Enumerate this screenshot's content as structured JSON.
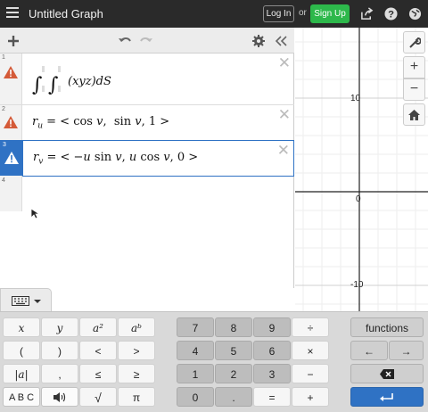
{
  "header": {
    "title": "Untitled Graph",
    "login_label": "Log In",
    "or_label": "or",
    "signup_label": "Sign Up",
    "signup_color": "#2db84b",
    "icons": [
      "menu-icon",
      "share-icon",
      "help-icon",
      "language-icon"
    ]
  },
  "expressions": [
    {
      "number": "1",
      "status": "warning",
      "latex": "∫∫(xyz)dS"
    },
    {
      "number": "2",
      "status": "warning",
      "latex": "r_u = < cos v, sin v, 1 >"
    },
    {
      "number": "3",
      "status": "warning",
      "latex": "r_v = < −u sin v, u cos v, 0 >"
    },
    {
      "number": "4",
      "status": "empty",
      "latex": ""
    }
  ],
  "graph": {
    "y_tick_10": "10",
    "y_tick_0": "0",
    "y_tick_neg10": "-10"
  },
  "keypad": {
    "row1": [
      "x",
      "y",
      "a²",
      "aᵇ",
      "7",
      "8",
      "9",
      "÷",
      "functions"
    ],
    "row2": [
      "(",
      ")",
      "<",
      ">",
      "4",
      "5",
      "6",
      "×",
      "←",
      "→"
    ],
    "row3": [
      "|a|",
      ",",
      "≤",
      "≥",
      "1",
      "2",
      "3",
      "−",
      "backspace"
    ],
    "row4": [
      "A B C",
      "sound",
      "√",
      "π",
      "0",
      ".",
      "=",
      "+",
      "enter"
    ],
    "accent_color": "#2f72c4"
  }
}
